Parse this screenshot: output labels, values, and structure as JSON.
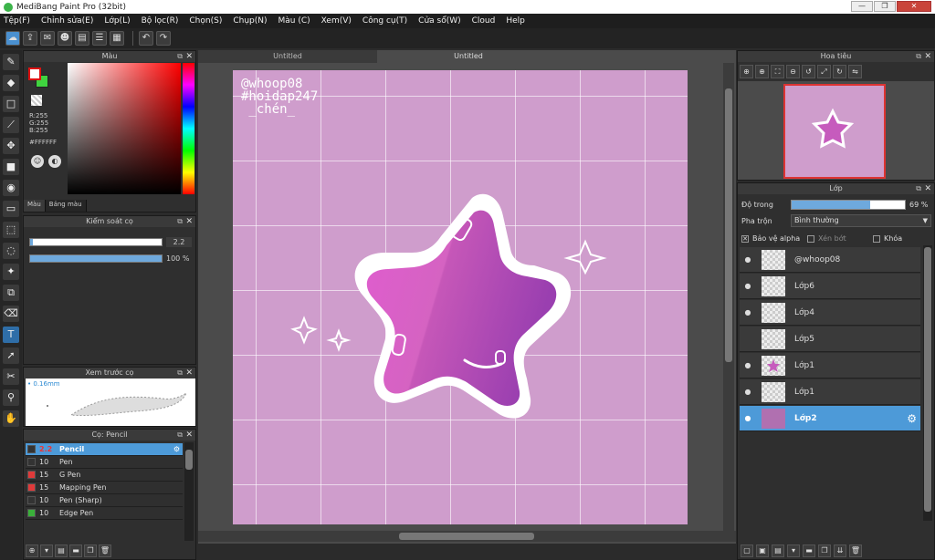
{
  "window": {
    "title": "MediBang Paint Pro (32bit)"
  },
  "menu": [
    "Tệp(F)",
    "Chỉnh sửa(E)",
    "Lớp(L)",
    "Bộ lọc(R)",
    "Chọn(S)",
    "Chụp(N)",
    "Màu (C)",
    "Xem(V)",
    "Công cụ(T)",
    "Cửa sổ(W)",
    "Cloud",
    "Help"
  ],
  "colorPanel": {
    "title": "Màu",
    "r": "R:255",
    "g": "G:255",
    "b": "B:255",
    "hex": "#FFFFFF",
    "tabs": [
      "Màu",
      "Bảng màu"
    ],
    "foreground": "#ffffff",
    "background": "#3fd43f"
  },
  "brushControl": {
    "title": "Kiểm soát cọ",
    "size": "2.2",
    "opacity": "100 %"
  },
  "brushPreview": {
    "title": "Xem trước cọ",
    "size_label": "0.16mm"
  },
  "brushes": {
    "title": "Cọ: Pencil",
    "items": [
      {
        "size": "2.2",
        "name": "Pencil",
        "color": "#333333",
        "selected": true
      },
      {
        "size": "10",
        "name": "Pen",
        "color": "#333333"
      },
      {
        "size": "15",
        "name": "G Pen",
        "color": "#e03a3a"
      },
      {
        "size": "15",
        "name": "Mapping Pen",
        "color": "#e03a3a"
      },
      {
        "size": "10",
        "name": "Pen (Sharp)",
        "color": "#333333"
      },
      {
        "size": "10",
        "name": "Edge Pen",
        "color": "#3ab03a"
      }
    ]
  },
  "document": {
    "tabs": [
      "Untitled",
      "Untitled"
    ],
    "canvas_text": "@whoop08\n#hoidap247\n _chén_",
    "canvas_color": "#cf9dcc"
  },
  "navigator": {
    "title": "Hoa tiêu"
  },
  "layers": {
    "title": "Lớp",
    "opacity_label": "Độ trong",
    "opacity_value": "69 %",
    "opacity": 0.69,
    "blend_label": "Pha trộn",
    "blend_value": "Bình thường",
    "options": {
      "protect_alpha": "Bảo vệ alpha",
      "clip": "Xén bớt",
      "lock": "Khóa"
    },
    "items": [
      {
        "name": "@whoop08",
        "visible": true
      },
      {
        "name": "Lớp6",
        "visible": true
      },
      {
        "name": "Lớp4",
        "visible": true
      },
      {
        "name": "Lớp5",
        "visible": false
      },
      {
        "name": "Lớp1",
        "visible": true
      },
      {
        "name": "Lớp1",
        "visible": true
      },
      {
        "name": "Lớp2",
        "visible": true,
        "selected": true
      }
    ]
  }
}
